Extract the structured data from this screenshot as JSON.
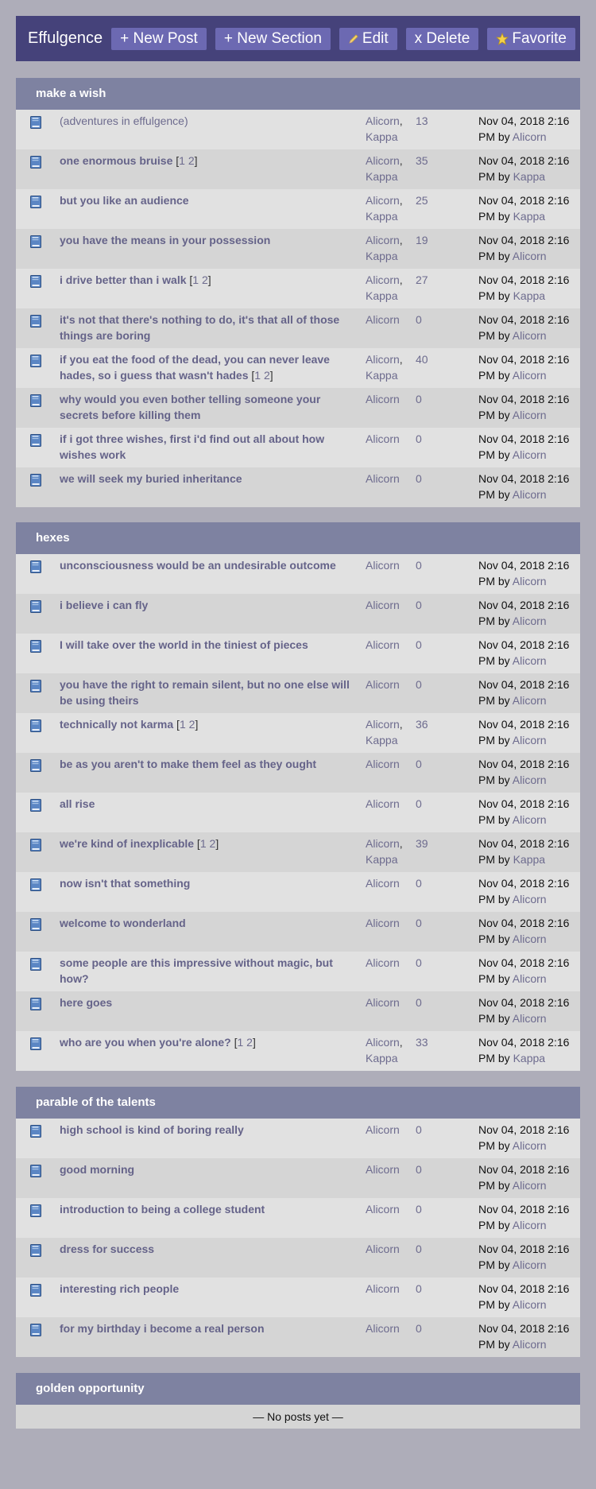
{
  "header": {
    "brand": "Effulgence",
    "buttons": [
      {
        "label": "+ New Post",
        "icon": ""
      },
      {
        "label": "+ New Section",
        "icon": ""
      },
      {
        "label": "Edit",
        "icon": "pencil-icon"
      },
      {
        "label": "x Delete",
        "icon": ""
      },
      {
        "label": "Favorite",
        "icon": "star-icon"
      }
    ]
  },
  "sections": [
    {
      "title": "make a wish",
      "posts": [
        {
          "title": "(adventures in effulgence)",
          "plain": true,
          "pages": [],
          "authors": [
            "Alicorn",
            "Kappa"
          ],
          "count": "13",
          "date": "Nov 04, 2018 2:16 PM",
          "by": "Alicorn"
        },
        {
          "title": "one enormous bruise",
          "pages": [
            "1",
            "2"
          ],
          "authors": [
            "Alicorn",
            "Kappa"
          ],
          "count": "35",
          "date": "Nov 04, 2018 2:16 PM",
          "by": "Kappa"
        },
        {
          "title": "but you like an audience",
          "pages": [],
          "authors": [
            "Alicorn",
            "Kappa"
          ],
          "count": "25",
          "date": "Nov 04, 2018 2:16 PM",
          "by": "Kappa"
        },
        {
          "title": "you have the means in your possession",
          "pages": [],
          "authors": [
            "Alicorn",
            "Kappa"
          ],
          "count": "19",
          "date": "Nov 04, 2018 2:16 PM",
          "by": "Alicorn"
        },
        {
          "title": "i drive better than i walk",
          "pages": [
            "1",
            "2"
          ],
          "authors": [
            "Alicorn",
            "Kappa"
          ],
          "count": "27",
          "date": "Nov 04, 2018 2:16 PM",
          "by": "Kappa"
        },
        {
          "title": "it's not that there's nothing to do, it's that all of those things are boring",
          "pages": [],
          "authors": [
            "Alicorn"
          ],
          "count": "0",
          "date": "Nov 04, 2018 2:16 PM",
          "by": "Alicorn"
        },
        {
          "title": "if you eat the food of the dead, you can never leave hades, so i guess that wasn't hades",
          "pages": [
            "1",
            "2"
          ],
          "authors": [
            "Alicorn",
            "Kappa"
          ],
          "count": "40",
          "date": "Nov 04, 2018 2:16 PM",
          "by": "Alicorn"
        },
        {
          "title": "why would you even bother telling someone your secrets before killing them",
          "pages": [],
          "authors": [
            "Alicorn"
          ],
          "count": "0",
          "date": "Nov 04, 2018 2:16 PM",
          "by": "Alicorn"
        },
        {
          "title": "if i got three wishes, first i'd find out all about how wishes work",
          "pages": [],
          "authors": [
            "Alicorn"
          ],
          "count": "0",
          "date": "Nov 04, 2018 2:16 PM",
          "by": "Alicorn"
        },
        {
          "title": "we will seek my buried inheritance",
          "pages": [],
          "authors": [
            "Alicorn"
          ],
          "count": "0",
          "date": "Nov 04, 2018 2:16 PM",
          "by": "Alicorn"
        }
      ]
    },
    {
      "title": "hexes",
      "posts": [
        {
          "title": "unconsciousness would be an undesirable outcome",
          "pages": [],
          "authors": [
            "Alicorn"
          ],
          "count": "0",
          "date": "Nov 04, 2018 2:16 PM",
          "by": "Alicorn"
        },
        {
          "title": "i believe i can fly",
          "pages": [],
          "authors": [
            "Alicorn"
          ],
          "count": "0",
          "date": "Nov 04, 2018 2:16 PM",
          "by": "Alicorn"
        },
        {
          "title": "I will take over the world in the tiniest of pieces",
          "pages": [],
          "authors": [
            "Alicorn"
          ],
          "count": "0",
          "date": "Nov 04, 2018 2:16 PM",
          "by": "Alicorn"
        },
        {
          "title": "you have the right to remain silent, but no one else will be using theirs",
          "pages": [],
          "authors": [
            "Alicorn"
          ],
          "count": "0",
          "date": "Nov 04, 2018 2:16 PM",
          "by": "Alicorn"
        },
        {
          "title": "technically not karma",
          "pages": [
            "1",
            "2"
          ],
          "authors": [
            "Alicorn",
            "Kappa"
          ],
          "count": "36",
          "date": "Nov 04, 2018 2:16 PM",
          "by": "Alicorn"
        },
        {
          "title": "be as you aren't to make them feel as they ought",
          "pages": [],
          "authors": [
            "Alicorn"
          ],
          "count": "0",
          "date": "Nov 04, 2018 2:16 PM",
          "by": "Alicorn"
        },
        {
          "title": "all rise",
          "pages": [],
          "authors": [
            "Alicorn"
          ],
          "count": "0",
          "date": "Nov 04, 2018 2:16 PM",
          "by": "Alicorn"
        },
        {
          "title": "we're kind of inexplicable",
          "pages": [
            "1",
            "2"
          ],
          "authors": [
            "Alicorn",
            "Kappa"
          ],
          "count": "39",
          "date": "Nov 04, 2018 2:16 PM",
          "by": "Kappa"
        },
        {
          "title": "now isn't that something",
          "pages": [],
          "authors": [
            "Alicorn"
          ],
          "count": "0",
          "date": "Nov 04, 2018 2:16 PM",
          "by": "Alicorn"
        },
        {
          "title": "welcome to wonderland",
          "pages": [],
          "authors": [
            "Alicorn"
          ],
          "count": "0",
          "date": "Nov 04, 2018 2:16 PM",
          "by": "Alicorn"
        },
        {
          "title": "some people are this impressive without magic, but how?",
          "pages": [],
          "authors": [
            "Alicorn"
          ],
          "count": "0",
          "date": "Nov 04, 2018 2:16 PM",
          "by": "Alicorn"
        },
        {
          "title": "here goes",
          "pages": [],
          "authors": [
            "Alicorn"
          ],
          "count": "0",
          "date": "Nov 04, 2018 2:16 PM",
          "by": "Alicorn"
        },
        {
          "title": "who are you when you're alone?",
          "pages": [
            "1",
            "2"
          ],
          "authors": [
            "Alicorn",
            "Kappa"
          ],
          "count": "33",
          "date": "Nov 04, 2018 2:16 PM",
          "by": "Kappa"
        }
      ]
    },
    {
      "title": "parable of the talents",
      "posts": [
        {
          "title": "high school is kind of boring really",
          "pages": [],
          "authors": [
            "Alicorn"
          ],
          "count": "0",
          "date": "Nov 04, 2018 2:16 PM",
          "by": "Alicorn"
        },
        {
          "title": "good morning",
          "pages": [],
          "authors": [
            "Alicorn"
          ],
          "count": "0",
          "date": "Nov 04, 2018 2:16 PM",
          "by": "Alicorn"
        },
        {
          "title": "introduction to being a college student",
          "pages": [],
          "authors": [
            "Alicorn"
          ],
          "count": "0",
          "date": "Nov 04, 2018 2:16 PM",
          "by": "Alicorn"
        },
        {
          "title": "dress for success",
          "pages": [],
          "authors": [
            "Alicorn"
          ],
          "count": "0",
          "date": "Nov 04, 2018 2:16 PM",
          "by": "Alicorn"
        },
        {
          "title": "interesting rich people",
          "pages": [],
          "authors": [
            "Alicorn"
          ],
          "count": "0",
          "date": "Nov 04, 2018 2:16 PM",
          "by": "Alicorn"
        },
        {
          "title": "for my birthday i become a real person",
          "pages": [],
          "authors": [
            "Alicorn"
          ],
          "count": "0",
          "date": "Nov 04, 2018 2:16 PM",
          "by": "Alicorn"
        }
      ]
    },
    {
      "title": "golden opportunity",
      "posts": [],
      "empty_text": "— No posts yet —"
    }
  ]
}
